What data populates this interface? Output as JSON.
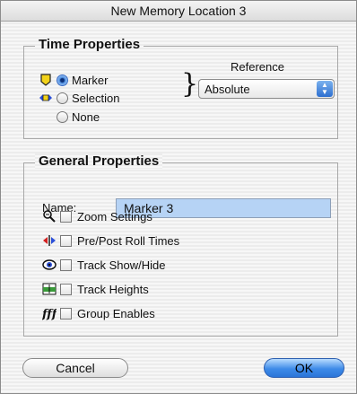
{
  "window": {
    "title": "New Memory Location 3"
  },
  "time_properties": {
    "title": "Time Properties",
    "options": [
      {
        "label": "Marker",
        "selected": true,
        "icon": "marker-icon"
      },
      {
        "label": "Selection",
        "selected": false,
        "icon": "selection-icon"
      },
      {
        "label": "None",
        "selected": false
      }
    ],
    "reference": {
      "label": "Reference",
      "value": "Absolute"
    }
  },
  "general_properties": {
    "title": "General Properties",
    "name_label": "Name:",
    "name_value": "Marker 3",
    "checkboxes": [
      {
        "label": "Zoom Settings",
        "checked": false,
        "icon": "zoom-icon"
      },
      {
        "label": "Pre/Post Roll Times",
        "checked": false,
        "icon": "pre-post-roll-icon"
      },
      {
        "label": "Track Show/Hide",
        "checked": false,
        "icon": "eye-icon"
      },
      {
        "label": "Track Heights",
        "checked": false,
        "icon": "track-heights-icon"
      },
      {
        "label": "Group Enables",
        "checked": false,
        "icon": "group-enables-icon"
      }
    ]
  },
  "buttons": {
    "cancel": "Cancel",
    "ok": "OK"
  },
  "colors": {
    "accent": "#3e8be8",
    "name_field_bg": "#b6d3f5"
  }
}
